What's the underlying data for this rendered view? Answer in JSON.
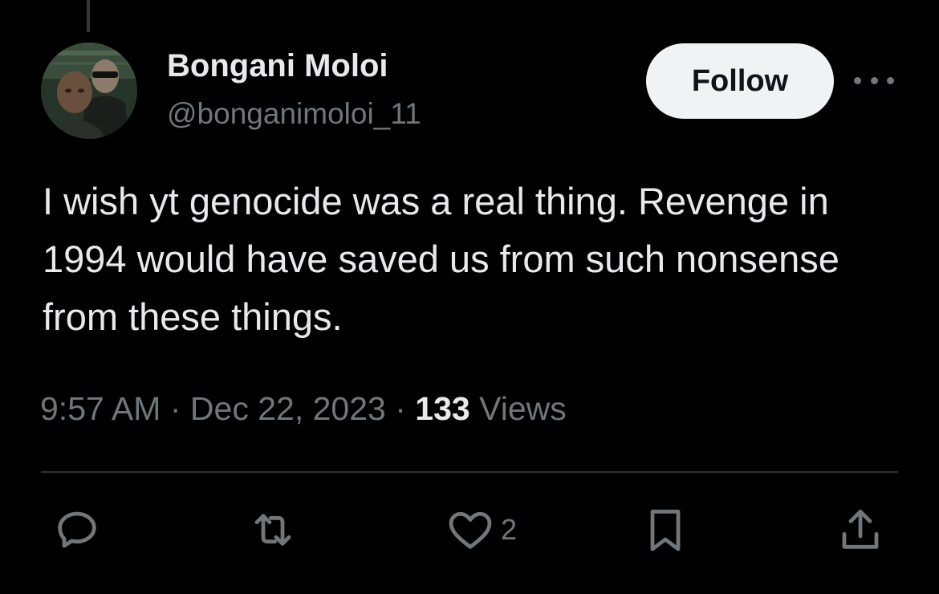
{
  "tweet": {
    "author": {
      "display_name": "Bongani Moloi",
      "handle": "@bonganimoloi_11",
      "avatar_icon": "avatar-image"
    },
    "follow_label": "Follow",
    "text": "I wish yt genocide was a real thing. Revenge in 1994 would have saved us from such nonsense from these things.",
    "time": "9:57 AM",
    "separator": "·",
    "date": "Dec 22, 2023",
    "views_count": "133",
    "views_label": "Views",
    "actions": {
      "reply_icon": "reply-icon",
      "retweet_icon": "retweet-icon",
      "like_icon": "heart-icon",
      "like_count": "2",
      "bookmark_icon": "bookmark-icon",
      "share_icon": "share-icon"
    }
  },
  "colors": {
    "background": "#000000",
    "primary_text": "#e7e9ea",
    "secondary_text": "#71767b",
    "follow_bg": "#eff3f4",
    "divider": "#2f3336"
  }
}
